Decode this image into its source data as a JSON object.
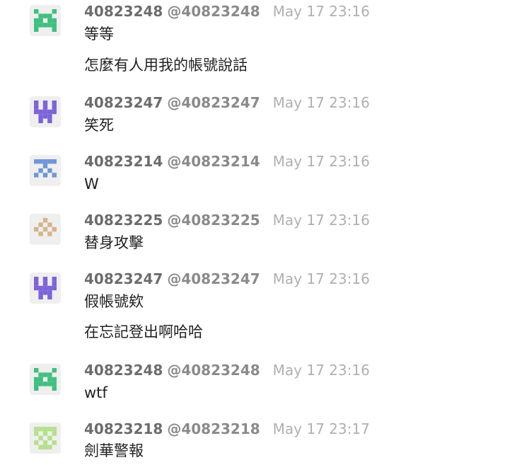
{
  "messages": [
    {
      "username": "40823248",
      "handle": "@40823248",
      "time": "May 17 23:16",
      "avatar": {
        "name": "avatar-green-invader",
        "color": "#3fbf7f"
      },
      "lines": [
        "等等",
        "怎麼有人用我的帳號說話"
      ]
    },
    {
      "username": "40823247",
      "handle": "@40823247",
      "time": "May 17 23:16",
      "avatar": {
        "name": "avatar-purple-castle",
        "color": "#7b63d9"
      },
      "lines": [
        "笑死"
      ]
    },
    {
      "username": "40823214",
      "handle": "@40823214",
      "time": "May 17 23:16",
      "avatar": {
        "name": "avatar-blue-table",
        "color": "#6f96d6"
      },
      "lines": [
        "W"
      ]
    },
    {
      "username": "40823225",
      "handle": "@40823225",
      "time": "May 17 23:16",
      "avatar": {
        "name": "avatar-tan-diamond",
        "color": "#d6b48a"
      },
      "lines": [
        "替身攻擊"
      ]
    },
    {
      "username": "40823247",
      "handle": "@40823247",
      "time": "May 17 23:16",
      "avatar": {
        "name": "avatar-purple-castle",
        "color": "#7b63d9"
      },
      "lines": [
        "假帳號欸",
        "在忘記登出啊哈哈"
      ]
    },
    {
      "username": "40823248",
      "handle": "@40823248",
      "time": "May 17 23:16",
      "avatar": {
        "name": "avatar-green-invader",
        "color": "#3fbf7f"
      },
      "lines": [
        "wtf"
      ]
    },
    {
      "username": "40823218",
      "handle": "@40823218",
      "time": "May 17 23:17",
      "avatar": {
        "name": "avatar-lightgreen-checker",
        "color": "#b5e08c"
      },
      "lines": [
        "劍華警報"
      ]
    }
  ]
}
